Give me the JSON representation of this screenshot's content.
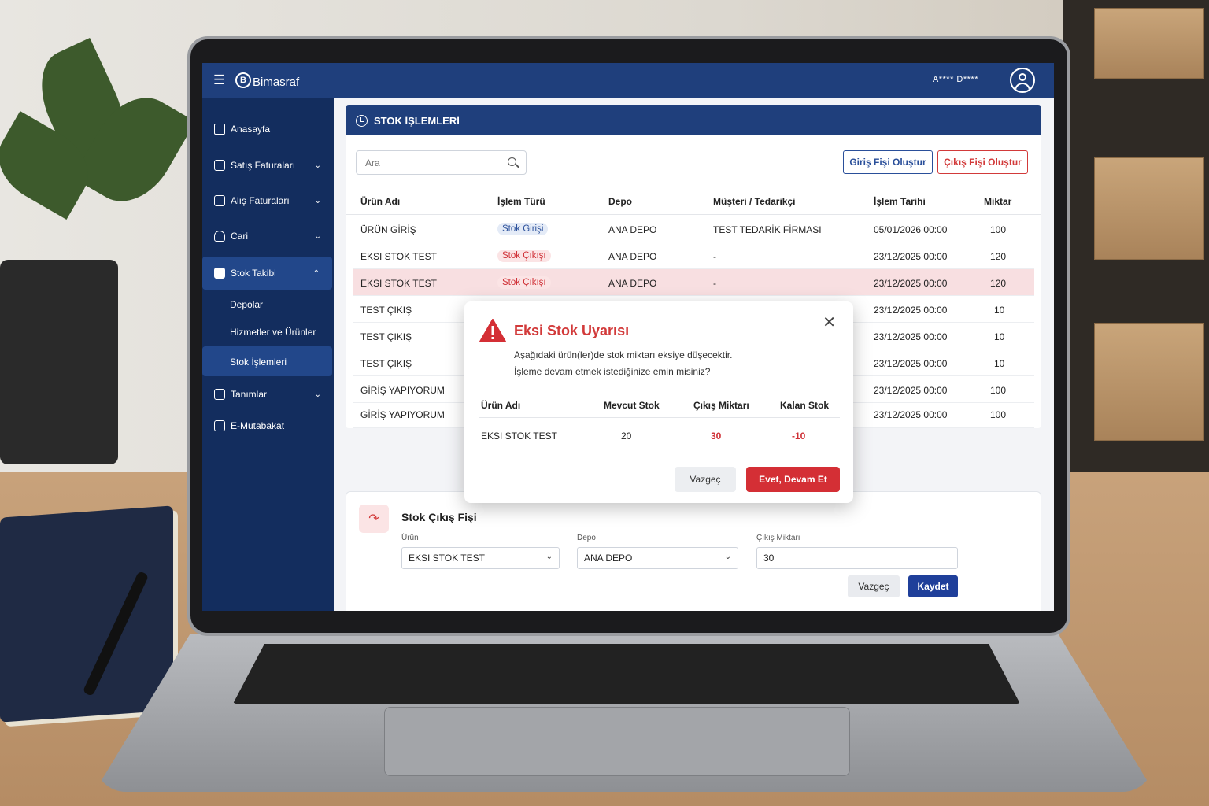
{
  "app": {
    "logo_mark": "B",
    "logo_text": "Bimasraf",
    "username": "A**** D****"
  },
  "sidebar": {
    "items": [
      {
        "label": "Anasayfa"
      },
      {
        "label": "Satış Faturaları"
      },
      {
        "label": "Alış Faturaları"
      },
      {
        "label": "Cari"
      },
      {
        "label": "Stok Takibi"
      },
      {
        "label": "Tanımlar"
      },
      {
        "label": "E-Mutabakat"
      }
    ],
    "subitems": [
      {
        "label": "Depolar"
      },
      {
        "label": "Hizmetler ve Ürünler"
      },
      {
        "label": "Stok İşlemleri"
      }
    ]
  },
  "panel": {
    "title": "STOK İŞLEMLERİ",
    "search_placeholder": "Ara",
    "btn_giris": "Giriş Fişi Oluştur",
    "btn_cikis": "Çıkış Fişi Oluştur"
  },
  "table": {
    "columns": [
      "Ürün Adı",
      "İşlem Türü",
      "Depo",
      "Müşteri / Tedarikçi",
      "İşlem Tarihi",
      "Miktar"
    ],
    "rows": [
      {
        "urun": "ÜRÜN GİRİŞ",
        "tur": "Stok Girişi",
        "depo": "ANA DEPO",
        "musteri": "TEST TEDARİK FİRMASI",
        "tarih": "05/01/2026 00:00",
        "miktar": "100"
      },
      {
        "urun": "EKSI STOK TEST",
        "tur": "Stok Çıkışı",
        "depo": "ANA DEPO",
        "musteri": "-",
        "tarih": "23/12/2025 00:00",
        "miktar": "120"
      },
      {
        "urun": "EKSI STOK TEST",
        "tur": "Stok Çıkışı",
        "depo": "ANA DEPO",
        "musteri": "-",
        "tarih": "23/12/2025 00:00",
        "miktar": "120"
      },
      {
        "urun": "TEST ÇIKIŞ",
        "tarih": "23/12/2025 00:00",
        "miktar": "10"
      },
      {
        "urun": "TEST ÇIKIŞ",
        "tarih": "23/12/2025 00:00",
        "miktar": "10"
      },
      {
        "urun": "TEST ÇIKIŞ",
        "tarih": "23/12/2025 00:00",
        "miktar": "10"
      },
      {
        "urun": "GİRİŞ YAPIYORUM",
        "tarih": "23/12/2025 00:00",
        "miktar": "100"
      },
      {
        "urun": "GİRİŞ YAPIYORUM",
        "tarih": "23/12/2025 00:00",
        "miktar": "100"
      }
    ]
  },
  "form": {
    "title": "Stok Çıkış Fişi",
    "label_urun": "Ürün",
    "value_urun": "EKSI STOK TEST",
    "label_depo": "Depo",
    "value_depo": "ANA DEPO",
    "label_miktar": "Çıkış Miktarı",
    "value_miktar": "30",
    "btn_cancel": "Vazgeç",
    "btn_save": "Kaydet"
  },
  "modal": {
    "title": "Eksi Stok Uyarısı",
    "message_1": "Aşağıdaki ürün(ler)de stok miktarı eksiye düşecektir.",
    "message_2": "İşleme devam etmek istediğinize emin misiniz?",
    "columns": [
      "Ürün Adı",
      "Mevcut Stok",
      "Çıkış Miktarı",
      "Kalan Stok"
    ],
    "row": {
      "urun": "EKSI STOK TEST",
      "mevcut": "20",
      "cikis": "30",
      "kalan": "-10"
    },
    "btn_cancel": "Vazgeç",
    "btn_confirm": "Evet, Devam Et"
  },
  "colors": {
    "brand_navy": "#1f3f7c",
    "sidebar_bg": "#132d5e",
    "danger": "#d23a3a"
  }
}
